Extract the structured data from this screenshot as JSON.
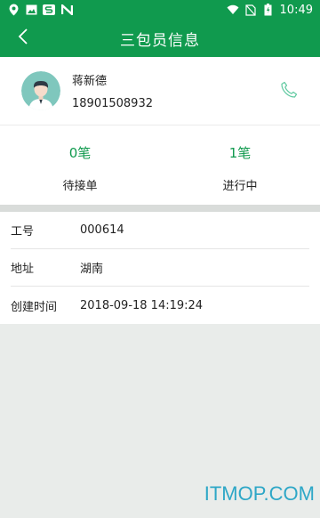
{
  "statusbar": {
    "time": "10:49",
    "icons": [
      "location-app-icon",
      "gallery-icon",
      "s-app-icon",
      "n-app-icon",
      "wifi-icon",
      "no-sim-icon",
      "battery-icon"
    ]
  },
  "topbar": {
    "title": "三包员信息",
    "back_icon": "chevron-left-icon"
  },
  "profile": {
    "name": "蒋新德",
    "phone": "18901508932",
    "avatar": "avatar-man",
    "call_icon": "phone-icon"
  },
  "stats": [
    {
      "value": "0笔",
      "label": "待接单"
    },
    {
      "value": "1笔",
      "label": "进行中"
    }
  ],
  "info": {
    "rows": [
      {
        "label": "工号",
        "value": "000614"
      },
      {
        "label": "地址",
        "value": "湖南"
      },
      {
        "label": "创建时间",
        "value": "2018-09-18 14:19:24"
      }
    ]
  },
  "watermark": "ITMOP.COM",
  "colors": {
    "brand": "#109a4e",
    "background": "#e9ecea",
    "watermark": "#2ea7c7"
  }
}
